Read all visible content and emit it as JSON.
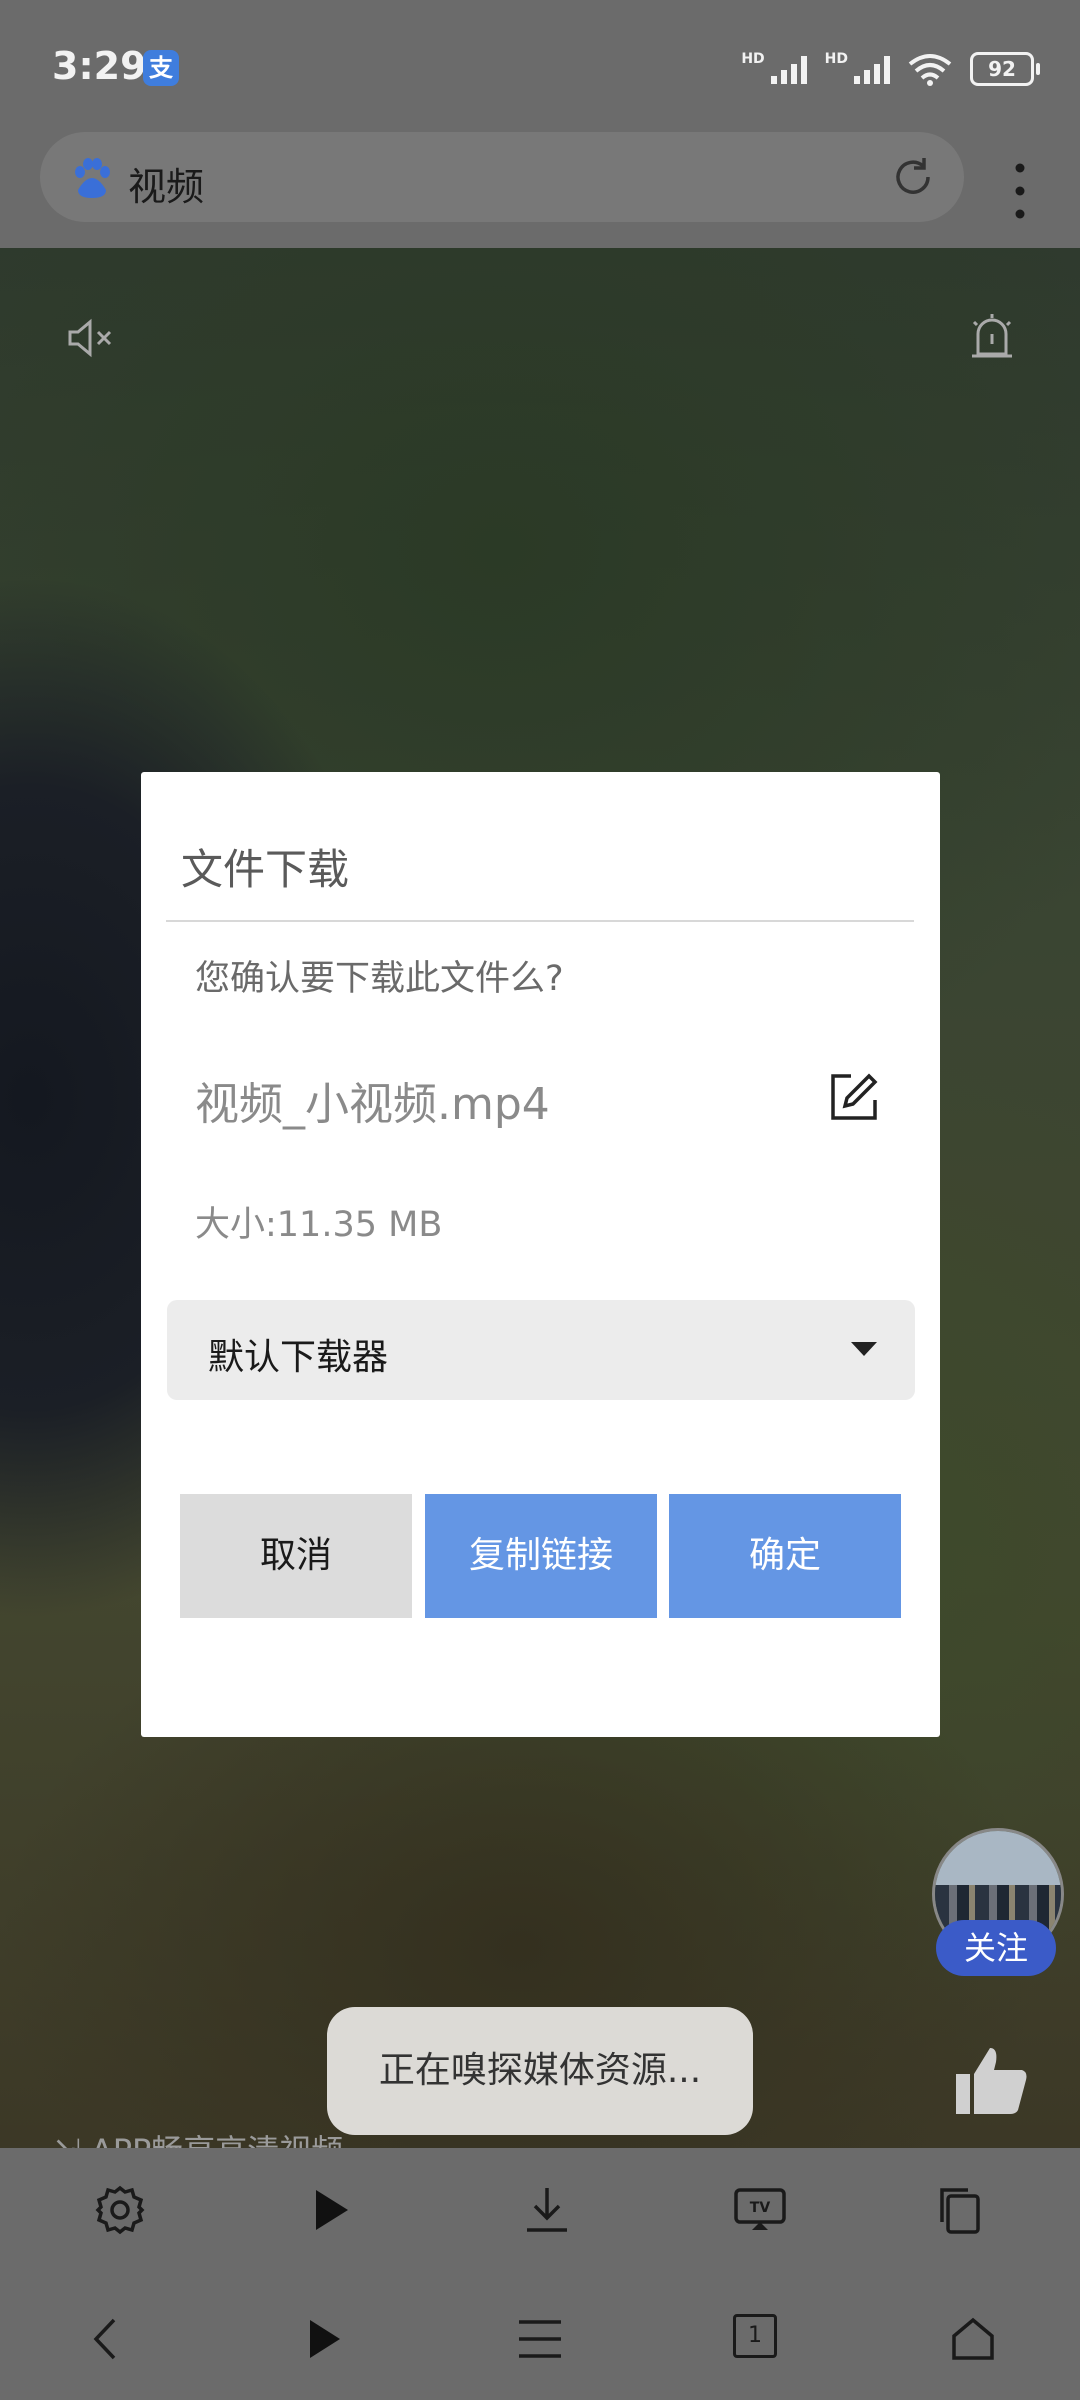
{
  "status_bar": {
    "time": "3:29",
    "app_badge": "支",
    "network_label_1": "HD",
    "network_label_2": "HD",
    "battery": "92"
  },
  "address_bar": {
    "title": "视频",
    "icons": [
      "baidu-logo-icon",
      "refresh-icon",
      "more-vert-icon"
    ]
  },
  "video": {
    "icons": [
      "mute-icon",
      "alarm-icon",
      "like-icon"
    ],
    "follow_label": "关注",
    "app_hint": "APP畅享高清视频"
  },
  "dialog": {
    "title": "文件下载",
    "confirm_text": "您确认要下载此文件么?",
    "filename": "视频_小视频.mp4",
    "file_size": "大小:11.35 MB",
    "downloader": "默认下载器",
    "buttons": {
      "cancel": "取消",
      "copy_link": "复制链接",
      "ok": "确定"
    },
    "accent_color": "#6496e4"
  },
  "toast": "正在嗅探媒体资源...",
  "toolbar": {
    "icons": [
      "settings-icon",
      "play-icon",
      "download-icon",
      "cast-tv-icon",
      "copy-icon"
    ]
  },
  "navbar": {
    "icons": [
      "back-icon",
      "play-icon",
      "menu-icon",
      "tabs-icon",
      "home-icon"
    ],
    "tab_count": "1"
  }
}
